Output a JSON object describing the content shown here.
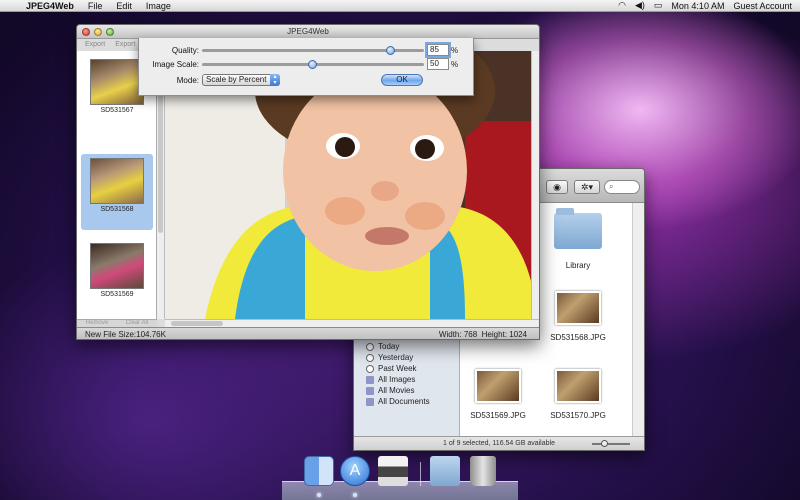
{
  "menubar": {
    "apple_glyph": "",
    "app_name": "JPEG4Web",
    "menus": [
      "File",
      "Edit",
      "Image"
    ],
    "clock": "Mon 4:10 AM",
    "user": "Guest Account",
    "status_icons": [
      "wifi-icon",
      "volume-icon",
      "battery-icon"
    ]
  },
  "jpeg4web": {
    "title": "JPEG4Web",
    "toolbar": [
      "Export",
      "Export"
    ],
    "thumbnails": [
      {
        "name": "SD531567",
        "selected": false
      },
      {
        "name": "SD531568",
        "selected": true
      },
      {
        "name": "SD531569",
        "selected": false
      },
      {
        "name": "",
        "selected": false
      }
    ],
    "thumb_actions": [
      "Remove",
      "Clear All"
    ],
    "new_file_size": "New File Size:104.76K",
    "width_label": "Width: 768",
    "height_label": "Height: 1024"
  },
  "settings": {
    "quality_label": "Quality:",
    "quality_value": "85",
    "quality_level": 0.85,
    "scale_label": "Image Scale:",
    "scale_value": "50",
    "scale_level": 0.5,
    "percent": "%",
    "mode_label": "Mode:",
    "mode_value": "Scale by Percent",
    "ok_label": "OK"
  },
  "finder": {
    "sidebar": [
      {
        "label": "Today",
        "icon": "clock-icon"
      },
      {
        "label": "Yesterday",
        "icon": "clock-icon"
      },
      {
        "label": "Past Week",
        "icon": "clock-icon"
      },
      {
        "label": "All Images",
        "icon": "smart-folder-icon"
      },
      {
        "label": "All Movies",
        "icon": "smart-folder-icon"
      },
      {
        "label": "All Documents",
        "icon": "smart-folder-icon"
      }
    ],
    "items": [
      {
        "label": "Library",
        "kind": "folder"
      },
      {
        "label": "SD531568.JPG",
        "kind": "image"
      },
      {
        "label": "SD531569.JPG",
        "kind": "image"
      },
      {
        "label": "SD531570.JPG",
        "kind": "image"
      }
    ],
    "status": "1 of 9 selected, 116.54 GB available",
    "search_glyph": "⌕"
  },
  "dock": {
    "items": [
      "finder-icon",
      "app-store-icon",
      "printer-icon",
      "applications-folder-icon",
      "trash-icon"
    ]
  }
}
